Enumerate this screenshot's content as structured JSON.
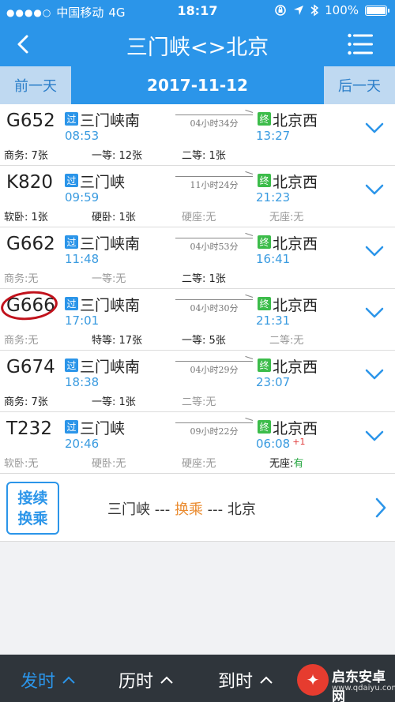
{
  "status": {
    "carrier": "中国移动",
    "network": "4G",
    "time": "18:17",
    "battery": "100%",
    "icons": [
      "signal-dots-icon",
      "orientation-lock-icon",
      "location-icon",
      "bluetooth-icon",
      "battery-icon"
    ]
  },
  "nav": {
    "title": "三门峡<>北京",
    "back_icon": "chevron-left-icon",
    "menu_icon": "list-menu-icon"
  },
  "datebar": {
    "prev": "前一天",
    "date": "2017-11-12",
    "next": "后一天"
  },
  "trains": [
    {
      "number": "G652",
      "pass_tag": "过",
      "from": "三门峡南",
      "dep": "08:53",
      "duration": "04小时34分",
      "end_tag": "终",
      "to": "北京西",
      "arr": "13:27",
      "next_day": "",
      "seats": [
        {
          "label": "商务: 7张",
          "available": true
        },
        {
          "label": "一等: 12张",
          "available": true
        },
        {
          "label": "二等: 1张",
          "available": true
        },
        {
          "label": "",
          "available": true
        }
      ]
    },
    {
      "number": "K820",
      "pass_tag": "过",
      "from": "三门峡",
      "dep": "09:59",
      "duration": "11小时24分",
      "end_tag": "终",
      "to": "北京西",
      "arr": "21:23",
      "next_day": "",
      "seats": [
        {
          "label": "软卧: 1张",
          "available": true
        },
        {
          "label": "硬卧: 1张",
          "available": true
        },
        {
          "label": "硬座:无",
          "available": false
        },
        {
          "label": "无座:无",
          "available": false
        }
      ]
    },
    {
      "number": "G662",
      "pass_tag": "过",
      "from": "三门峡南",
      "dep": "11:48",
      "duration": "04小时53分",
      "end_tag": "终",
      "to": "北京西",
      "arr": "16:41",
      "next_day": "",
      "seats": [
        {
          "label": "商务:无",
          "available": false
        },
        {
          "label": "一等:无",
          "available": false
        },
        {
          "label": "二等: 1张",
          "available": true
        },
        {
          "label": "",
          "available": true
        }
      ]
    },
    {
      "number": "G666",
      "pass_tag": "过",
      "from": "三门峡南",
      "dep": "17:01",
      "duration": "04小时30分",
      "end_tag": "终",
      "to": "北京西",
      "arr": "21:31",
      "next_day": "",
      "circled": true,
      "seats": [
        {
          "label": "商务:无",
          "available": false
        },
        {
          "label": "特等: 17张",
          "available": true
        },
        {
          "label": "一等: 5张",
          "available": true
        },
        {
          "label": "二等:无",
          "available": false
        }
      ]
    },
    {
      "number": "G674",
      "pass_tag": "过",
      "from": "三门峡南",
      "dep": "18:38",
      "duration": "04小时29分",
      "end_tag": "终",
      "to": "北京西",
      "arr": "23:07",
      "next_day": "",
      "seats": [
        {
          "label": "商务: 7张",
          "available": true
        },
        {
          "label": "一等: 1张",
          "available": true
        },
        {
          "label": "二等:无",
          "available": false
        },
        {
          "label": "",
          "available": true
        }
      ]
    },
    {
      "number": "T232",
      "pass_tag": "过",
      "from": "三门峡",
      "dep": "20:46",
      "duration": "09小时22分",
      "end_tag": "终",
      "to": "北京西",
      "arr": "06:08",
      "next_day": "+1",
      "seats": [
        {
          "label": "软卧:无",
          "available": false
        },
        {
          "label": "硬卧:无",
          "available": false
        },
        {
          "label": "硬座:无",
          "available": false
        },
        {
          "label": "无座:",
          "extra": "有",
          "available": true
        }
      ]
    }
  ],
  "transfer": {
    "button_line1": "接续",
    "button_line2": "换乘",
    "from": "三门峡",
    "sep1": " --- ",
    "highlight": "换乘",
    "sep2": " --- ",
    "to": "北京"
  },
  "bottom": {
    "items": [
      {
        "label": "发时",
        "active": true
      },
      {
        "label": "历时",
        "active": false
      },
      {
        "label": "到时",
        "active": false
      }
    ],
    "watermark_name": "启东安卓网",
    "watermark_url": "www.qdaiyu.com"
  },
  "colors": {
    "primary": "#2b95e9",
    "end_tag": "#3cbc4a",
    "time": "#3a9be0",
    "highlight": "#ea8b2f",
    "available_green": "#2aa844",
    "circle": "#c1121c"
  }
}
